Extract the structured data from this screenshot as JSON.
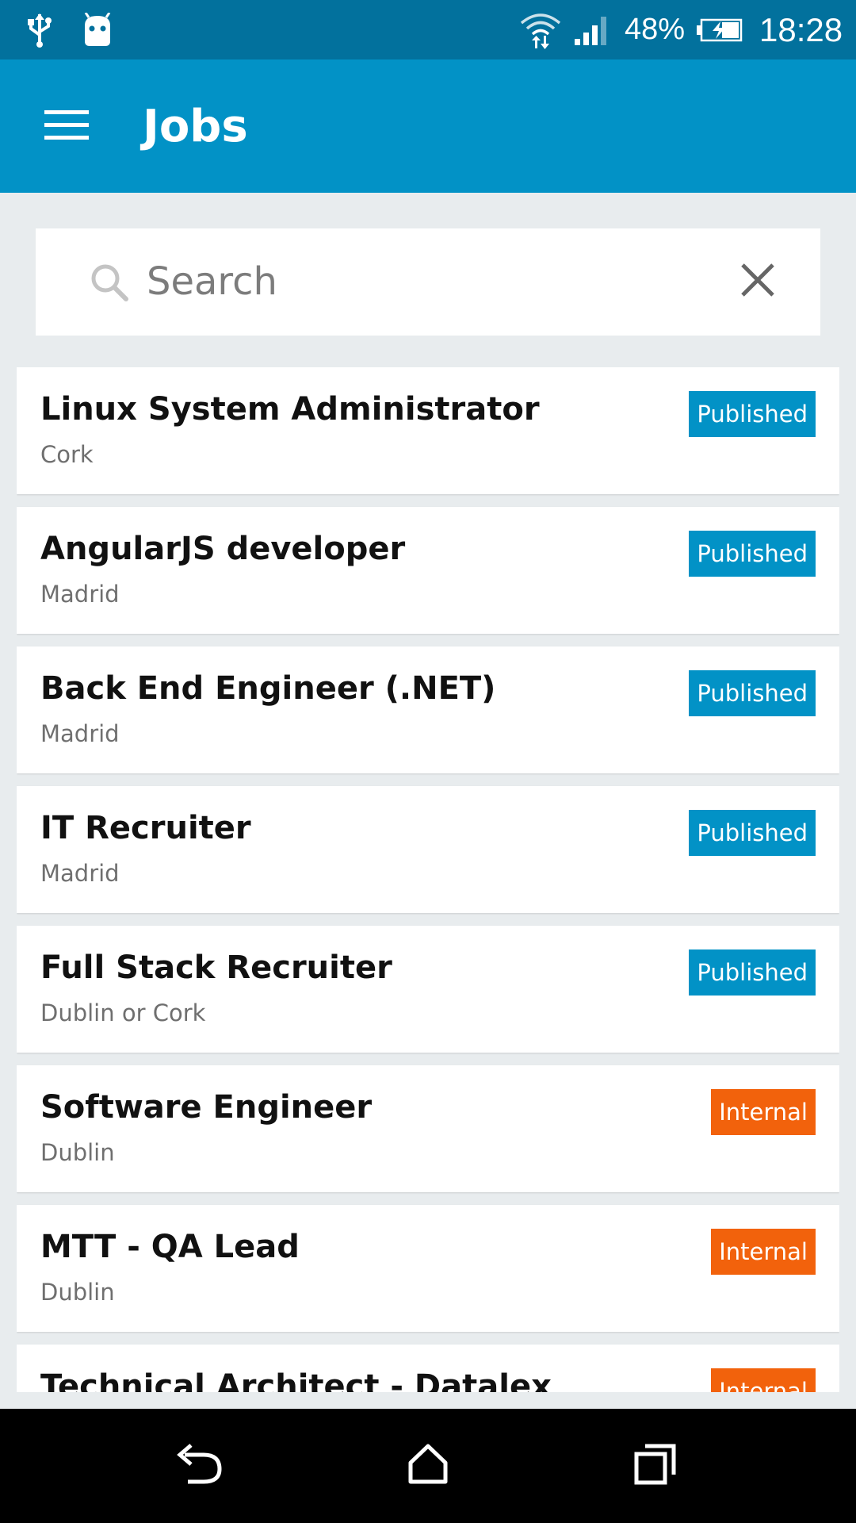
{
  "status_bar": {
    "battery_percent": "48%",
    "time": "18:28",
    "icons": [
      "usb-icon",
      "android-debug-icon",
      "wifi-icon",
      "cell-signal-icon",
      "battery-charging-icon"
    ]
  },
  "app_bar": {
    "title": "Jobs",
    "menu_icon": "hamburger-menu-icon"
  },
  "search": {
    "placeholder": "Search",
    "value": "",
    "icon": "search-icon",
    "clear_icon": "close-icon"
  },
  "jobs": [
    {
      "title": "Linux System Administrator",
      "location": "Cork",
      "status": "Published"
    },
    {
      "title": "AngularJS developer",
      "location": "Madrid",
      "status": "Published"
    },
    {
      "title": "Back End Engineer (.NET)",
      "location": "Madrid",
      "status": "Published"
    },
    {
      "title": "IT Recruiter",
      "location": "Madrid",
      "status": "Published"
    },
    {
      "title": "Full Stack Recruiter",
      "location": "Dublin or Cork",
      "status": "Published"
    },
    {
      "title": "Software Engineer",
      "location": "Dublin",
      "status": "Internal"
    },
    {
      "title": "MTT - QA Lead",
      "location": "Dublin",
      "status": "Internal"
    },
    {
      "title": "Technical Architect - Datalex",
      "location": "",
      "status": "Internal"
    }
  ],
  "colors": {
    "status_bar": "#02719d",
    "app_bar": "#0292c6",
    "background": "#e8ecee",
    "published_badge": "#0292c6",
    "internal_badge": "#f2620c",
    "nav_bar": "#000000"
  },
  "nav_bar": {
    "icons": [
      "back-icon",
      "home-icon",
      "recents-icon"
    ]
  }
}
